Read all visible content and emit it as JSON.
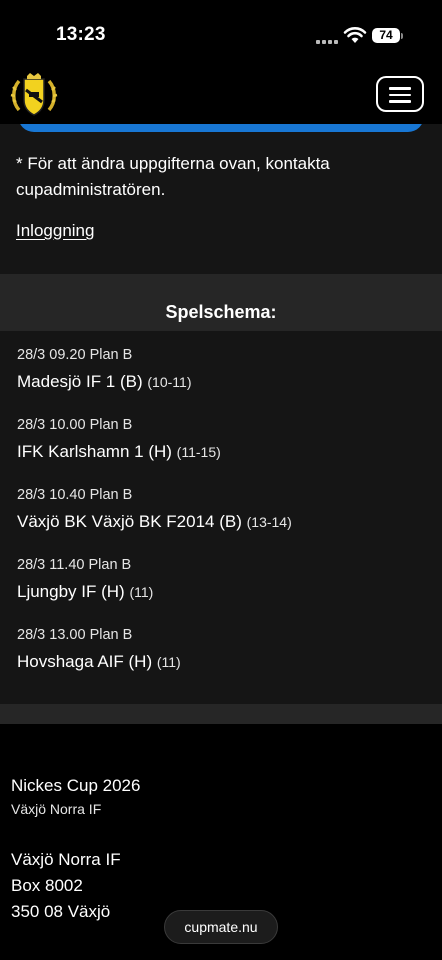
{
  "status": {
    "time": "13:23",
    "battery": "74"
  },
  "header": {
    "logo_icon": "club-crest-icon",
    "menu_icon": "hamburger-menu-icon"
  },
  "info": {
    "note": "* För att ändra uppgifterna ovan, kontakta cupadministratören.",
    "login_link": "Inloggning"
  },
  "schedule": {
    "title": "Spelschema:",
    "matches": [
      {
        "time": "28/3 09.20 Plan B",
        "team": "Madesjö IF 1 (B)",
        "group": "(10-11)"
      },
      {
        "time": "28/3 10.00 Plan B",
        "team": "IFK Karlshamn 1 (H)",
        "group": "(11-15)"
      },
      {
        "time": "28/3 10.40 Plan B",
        "team": "Växjö BK Växjö BK F2014 (B)",
        "group": "(13-14)"
      },
      {
        "time": "28/3 11.40 Plan B",
        "team": "Ljungby IF (H)",
        "group": "(11)"
      },
      {
        "time": "28/3 13.00 Plan B",
        "team": "Hovshaga AIF (H)",
        "group": "(11)"
      }
    ]
  },
  "footer": {
    "cup_name": "Nickes Cup 2026",
    "organizer": "Växjö Norra IF",
    "address": [
      "Växjö Norra IF",
      "Box 8002",
      "350 08 Växjö"
    ],
    "powered_by": "cupmate.nu"
  }
}
